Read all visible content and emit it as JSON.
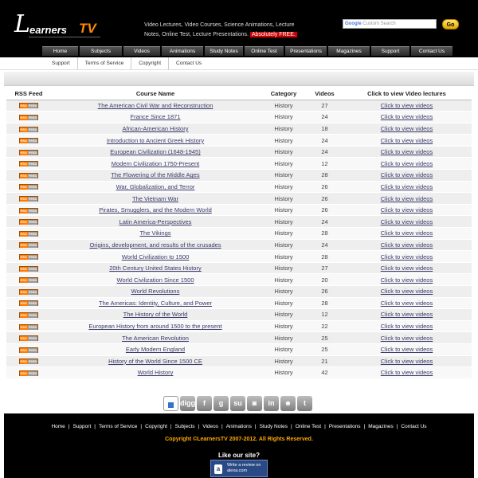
{
  "header": {
    "logo_text": "LearnersTV",
    "logo_parts": {
      "big_l": "L",
      "earners": "earners",
      "tv": "TV"
    },
    "tagline_prefix": "Video Lectures, Video Courses, Science Animations, Lecture Notes, Online Test, Lecture Presentations.",
    "tagline_free": "Absolutely FREE.",
    "search_google": "Google",
    "search_placeholder": "Custom Search",
    "go_label": "Go"
  },
  "main_nav": [
    "Home",
    "Subjects",
    "Videos",
    "Animations",
    "Study Notes",
    "Online Test",
    "Presentations",
    "Magazines",
    "Support",
    "Contact Us"
  ],
  "sub_nav": [
    "Support",
    "Terms of Service",
    "Copyright",
    "Contact Us"
  ],
  "table": {
    "headers": [
      "RSS Feed",
      "Course Name",
      "Category",
      "Videos",
      "Click to view Video lectures"
    ],
    "rss_badge": {
      "left": "RSS",
      "right": "FEED"
    },
    "rows": [
      {
        "name": "The American Civil War and Reconstruction",
        "category": "History",
        "videos": "27",
        "link": "Click to view videos"
      },
      {
        "name": "France Since 1871",
        "category": "History",
        "videos": "24",
        "link": "Click to view videos"
      },
      {
        "name": "African-American History",
        "category": "History",
        "videos": "18",
        "link": "Click to view videos"
      },
      {
        "name": "Introduction to Ancient Greek History",
        "category": "History",
        "videos": "24",
        "link": "Click to view videos"
      },
      {
        "name": "European Civilization (1648-1945)",
        "category": "History",
        "videos": "24",
        "link": "Click to view videos"
      },
      {
        "name": "Modern Civilization 1750-Present",
        "category": "History",
        "videos": "12",
        "link": "Click to view videos"
      },
      {
        "name": "The Flowering of the Middle Ages",
        "category": "History",
        "videos": "28",
        "link": "Click to view videos"
      },
      {
        "name": "War, Globalization, and Terror",
        "category": "History",
        "videos": "26",
        "link": "Click to view videos"
      },
      {
        "name": "The Vietnam War",
        "category": "History",
        "videos": "26",
        "link": "Click to view videos"
      },
      {
        "name": "Pirates, Smugglers, and the Modern World",
        "category": "History",
        "videos": "26",
        "link": "Click to view videos"
      },
      {
        "name": "Latin America-Perspectives",
        "category": "History",
        "videos": "24",
        "link": "Click to view videos"
      },
      {
        "name": "The Vikings",
        "category": "History",
        "videos": "28",
        "link": "Click to view videos"
      },
      {
        "name": "Origins, development, and results of the crusades",
        "category": "History",
        "videos": "24",
        "link": "Click to view videos"
      },
      {
        "name": "World Civilization to 1500",
        "category": "History",
        "videos": "28",
        "link": "Click to view videos"
      },
      {
        "name": "20th Century United States History",
        "category": "History",
        "videos": "27",
        "link": "Click to view videos"
      },
      {
        "name": "World Civilization Since 1500",
        "category": "History",
        "videos": "20",
        "link": "Click to view videos"
      },
      {
        "name": "World Revolutions",
        "category": "History",
        "videos": "26",
        "link": "Click to view videos"
      },
      {
        "name": "The Americas: Identity, Culture, and Power",
        "category": "History",
        "videos": "28",
        "link": "Click to view videos"
      },
      {
        "name": "The History of the World",
        "category": "History",
        "videos": "12",
        "link": "Click to view videos"
      },
      {
        "name": "European History from around 1500 to the present",
        "category": "History",
        "videos": "22",
        "link": "Click to view videos"
      },
      {
        "name": "The American Revolution",
        "category": "History",
        "videos": "25",
        "link": "Click to view videos"
      },
      {
        "name": "Early Modern England",
        "category": "History",
        "videos": "25",
        "link": "Click to view videos"
      },
      {
        "name": "History of the World Since 1500 CE",
        "category": "History",
        "videos": "21",
        "link": "Click to view videos"
      },
      {
        "name": "World History",
        "category": "History",
        "videos": "42",
        "link": "Click to view videos"
      }
    ]
  },
  "social": [
    {
      "icon": "delicious-icon",
      "glyph": ""
    },
    {
      "icon": "digg-icon",
      "glyph": "digg"
    },
    {
      "icon": "facebook-icon",
      "glyph": "f"
    },
    {
      "icon": "google-icon",
      "glyph": "g"
    },
    {
      "icon": "stumbleupon-icon",
      "glyph": "su"
    },
    {
      "icon": "chat-icon",
      "glyph": "◙"
    },
    {
      "icon": "linkedin-icon",
      "glyph": "in"
    },
    {
      "icon": "reddit-icon",
      "glyph": "☻"
    },
    {
      "icon": "twitter-icon",
      "glyph": "t"
    }
  ],
  "footer": {
    "nav": [
      "Home",
      "Support",
      "Terms of Service",
      "Copyright",
      "Subjects",
      "Videos",
      "Animations",
      "Study Notes",
      "Online Test",
      "Presentations",
      "Magazines",
      "Contact Us"
    ],
    "copyright": "Copyright ©LearnersTV 2007-2012. All Rights Reserved.",
    "like_title": "Like our site?",
    "alexa_icon": "a",
    "alexa_text": "Write a review on alexa.com"
  },
  "colors": {
    "header_bg": "#000000",
    "accent_orange": "#ff8a00",
    "free_badge": "#cc0000",
    "copyright": "#ffaa00",
    "alexa_badge": "#2a4a86"
  }
}
